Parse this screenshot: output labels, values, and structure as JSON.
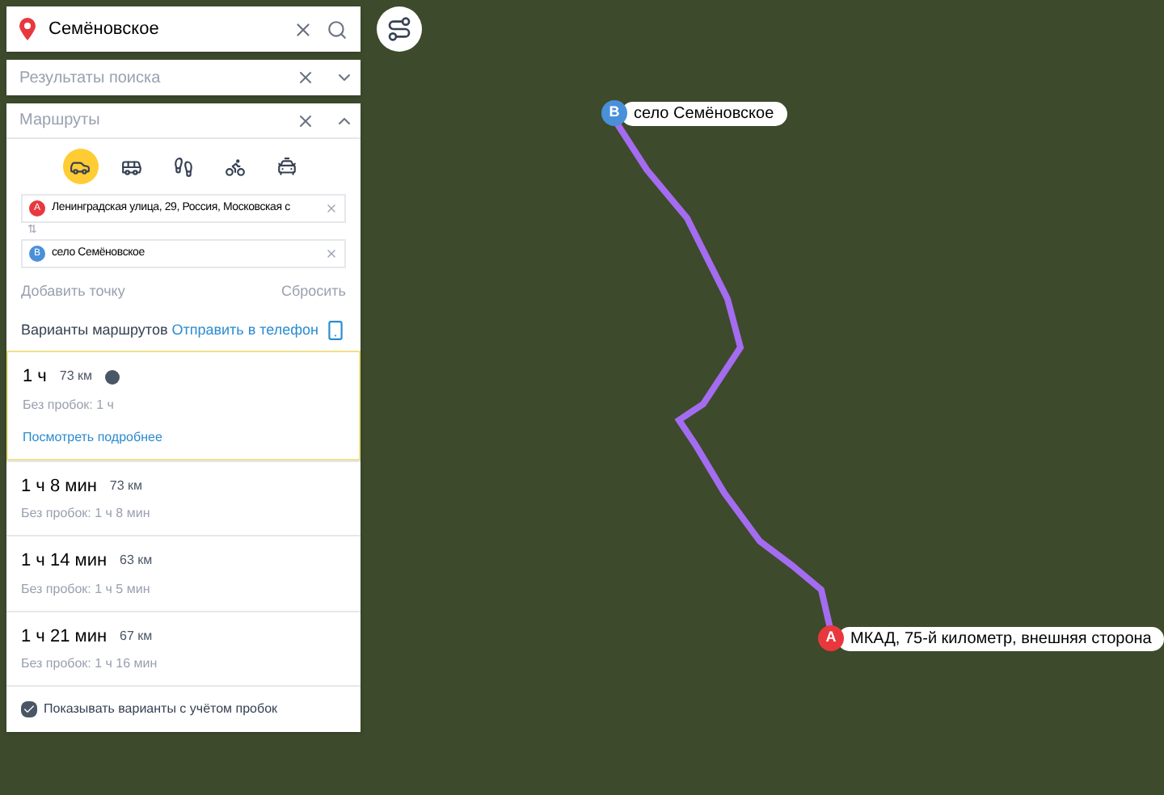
{
  "search": {
    "value": "Семёновское"
  },
  "results": {
    "title": "Результаты поиска"
  },
  "routes": {
    "title": "Маршруты",
    "expanded": true,
    "modes": [
      {
        "kind": "car",
        "selected": true
      },
      {
        "kind": "bus",
        "selected": false
      },
      {
        "kind": "walk",
        "selected": false
      },
      {
        "kind": "bike",
        "selected": false
      },
      {
        "kind": "taxi",
        "selected": false
      }
    ],
    "points": [
      {
        "marker": "A",
        "color": "#e8383d",
        "value": "Ленинградская улица, 29, Россия, Московская с"
      },
      {
        "marker": "B",
        "color": "#4a90d9",
        "value": "село Семёновское"
      }
    ],
    "swap": "⇅",
    "add_point": "Добавить точку",
    "reset": "Сбросить",
    "variants_title": "Варианты маршрутов",
    "send_to_phone": "Отправить в телефон",
    "options": [
      {
        "time": "1 ч",
        "distance": "73 км",
        "toll": true,
        "no_traffic": "Без пробок: 1 ч",
        "details": "Посмотреть подробнее",
        "selected": true
      },
      {
        "time": "1 ч 8 мин",
        "distance": "73 км",
        "toll": false,
        "no_traffic": "Без пробок: 1 ч 8 мин",
        "selected": false
      },
      {
        "time": "1 ч 14 мин",
        "distance": "63 км",
        "toll": false,
        "no_traffic": "Без пробок: 1 ч 5 мин",
        "selected": false
      },
      {
        "time": "1 ч 21 мин",
        "distance": "67 км",
        "toll": false,
        "no_traffic": "Без пробок: 1 ч 16 мин",
        "selected": false
      }
    ],
    "traffic_option": {
      "label": "Показывать варианты с учётом пробок",
      "checked": true
    }
  },
  "map": {
    "pins": [
      {
        "marker": "A",
        "color": "#e8383d",
        "label": "МКАД, 75-й километр, внешняя сторона"
      },
      {
        "marker": "B",
        "color": "#4a90d9",
        "label": "село Семёновское"
      }
    ]
  }
}
